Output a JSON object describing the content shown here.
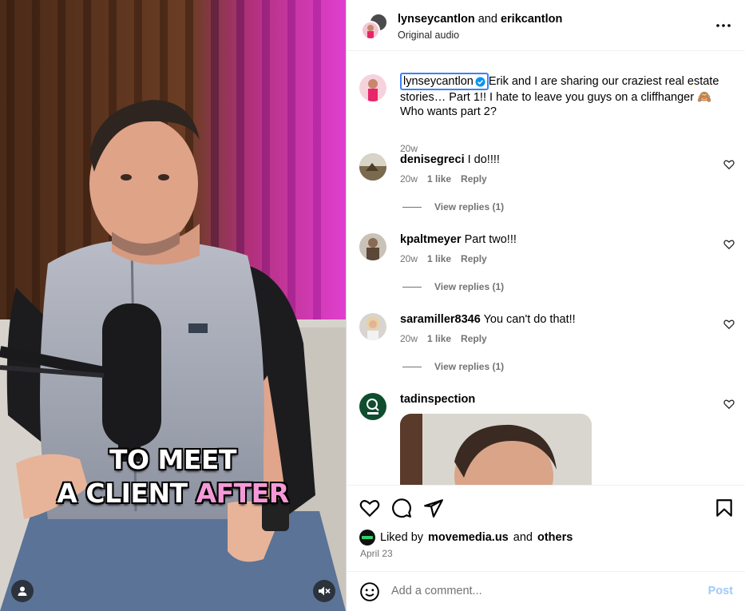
{
  "video": {
    "caption_line1": "TO MEET",
    "caption_line2_part1": "A CLIENT",
    "caption_line2_highlight": "AFTER",
    "user_icon": "person-icon",
    "mute_icon": "speaker-muted-icon"
  },
  "header": {
    "user1": "lynseycantlon",
    "connector": "and",
    "user2": "erikcantlon",
    "audio": "Original audio",
    "more_icon": "more-dots-icon"
  },
  "post_caption": {
    "username": "lynseycantlon",
    "text": "Erik and I are sharing our craziest real estate stories… Part 1!! I hate to leave you guys on a cliffhanger 🙈 Who wants part 2?",
    "time": "20w"
  },
  "comments": [
    {
      "username": "denisegreci",
      "text": "I do!!!!",
      "time": "20w",
      "likes": "1 like",
      "reply": "Reply",
      "replies": "View replies (1)"
    },
    {
      "username": "kpaltmeyer",
      "text": "Part two!!!",
      "time": "20w",
      "likes": "1 like",
      "reply": "Reply",
      "replies": "View replies (1)"
    },
    {
      "username": "saramiller8346",
      "text": "You can't do that!!",
      "time": "20w",
      "likes": "1 like",
      "reply": "Reply",
      "replies": "View replies (1)"
    },
    {
      "username": "tadinspection",
      "text": ""
    }
  ],
  "actions": {
    "like_icon": "heart-icon",
    "comment_icon": "comment-icon",
    "share_icon": "send-icon",
    "save_icon": "bookmark-icon"
  },
  "likes": {
    "prefix": "Liked by",
    "user": "movemedia.us",
    "connector": "and",
    "others": "others"
  },
  "date": "April 23",
  "add_comment": {
    "placeholder": "Add a comment...",
    "post": "Post",
    "emoji_icon": "emoji-icon"
  },
  "colors": {
    "accent": "#0095f6",
    "post_disabled": "#a3c9f9",
    "verified": "#0095f6",
    "highlight": "#f59ad8"
  }
}
